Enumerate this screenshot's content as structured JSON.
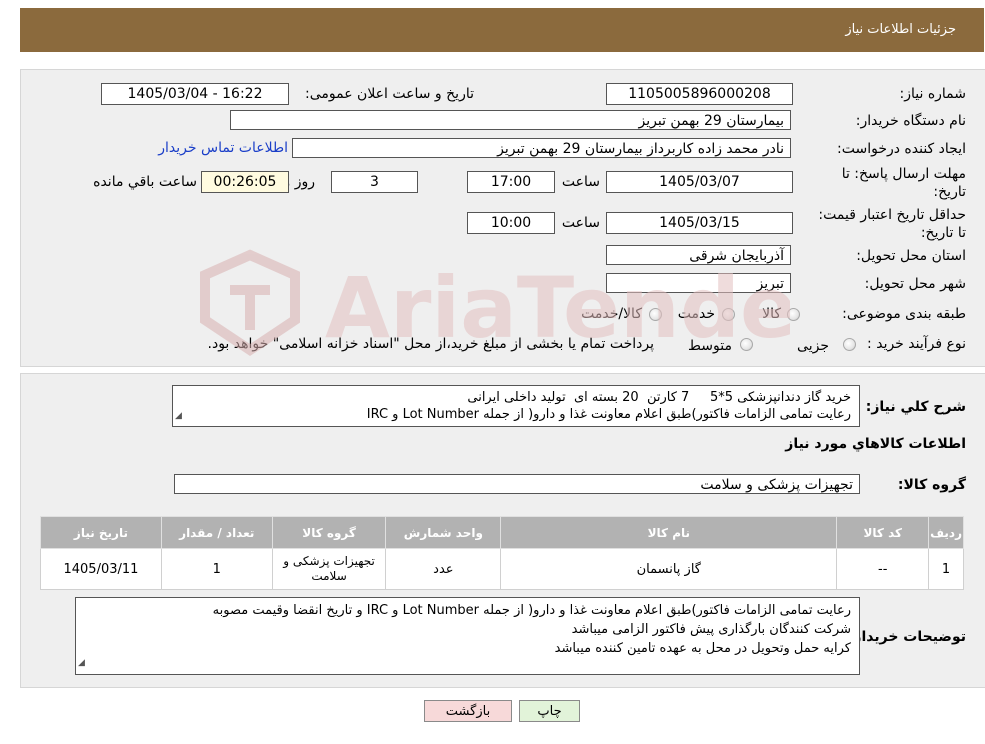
{
  "header": {
    "title": "جزئیات اطلاعات نیاز"
  },
  "info": {
    "need_number_label": "شماره نیاز:",
    "need_number": "1105005896000208",
    "announce_datetime_label": "تاریخ و ساعت اعلان عمومی:",
    "announce_datetime": "1405/03/04 - 16:22",
    "buyer_name_label": "نام دستگاه خریدار:",
    "buyer_name": "بیمارستان 29 بهمن تبریز",
    "creator_label": "ایجاد کننده درخواست:",
    "creator": "نادر محمد زاده کاربرداز بیمارستان 29 بهمن تبریز",
    "contact_link": "اطلاعات تماس خریدار",
    "deadline_label": "مهلت ارسال پاسخ: تا تاریخ:",
    "deadline_date": "1405/03/07",
    "time_label": "ساعت",
    "deadline_time": "17:00",
    "days": "3",
    "days_label": "روز و",
    "remaining": "00:26:05",
    "remaining_label": "ساعت باقي مانده",
    "validity_label": "حداقل تاریخ اعتبار قیمت: تا تاریخ:",
    "validity_date": "1405/03/15",
    "validity_time": "10:00",
    "province_label": "استان محل تحویل:",
    "province": "آذربایجان شرقی",
    "city_label": "شهر محل تحویل:",
    "city": "تبریز",
    "category_label": "طبقه بندی موضوعی:",
    "category_options": [
      "کالا",
      "خدمت",
      "کالا/خدمت"
    ],
    "purchase_type_label": "نوع فرآیند خرید :",
    "purchase_options": [
      "جزیی",
      "متوسط"
    ],
    "purchase_note": "پرداخت تمام یا بخشی از مبلغ خرید،از محل \"اسناد خزانه اسلامی\" خواهد بود."
  },
  "summary": {
    "label": "شرح کلي نیاز:",
    "line1": "خرید گاز دندانپزشکی 5*5     7 کارتن  20 بسته ای  تولید داخلی ایرانی",
    "line2": "رعایت تمامی الزامات فاکتور)طبق اعلام معاونت غذا و دارو( از جمله Lot Number و IRC"
  },
  "goods": {
    "section_title": "اطلاعات کالاهاي مورد نیاز",
    "group_label": "گروه کالا:",
    "group_value": "تجهیزات پزشکی و سلامت"
  },
  "table": {
    "headers": [
      "ردیف",
      "کد کالا",
      "نام کالا",
      "واحد شمارش",
      "گروه کالا",
      "تعداد / مقدار",
      "تاریخ نیاز"
    ],
    "rows": [
      [
        "1",
        "--",
        "گاز پانسمان",
        "عدد",
        "تجهیزات پزشکی و سلامت",
        "1",
        "1405/03/11"
      ]
    ]
  },
  "buyer_notes": {
    "label": "توضیحات خریدار:",
    "line1": "رعایت تمامی الزامات فاکتور)طبق اعلام معاونت غذا و دارو( از جمله Lot Number و IRC و تاریخ انقضا وقیمت مصوبه",
    "line2": "شرکت کنندگان بارگذاری پیش فاکتور الزامی میباشد",
    "line3": "کرایه حمل وتحویل در محل به عهده تامین کننده میباشد"
  },
  "buttons": {
    "print": "چاپ",
    "back": "بازگشت"
  },
  "watermark": {
    "text": "AriaTender.neT"
  },
  "colors": {
    "header": "#8b6a3d",
    "panel": "#efefef",
    "table_header": "#b2b2b2",
    "link": "#1a3ec8",
    "back_button": "#f7d9d9",
    "print_button": "#e2f3d9"
  }
}
